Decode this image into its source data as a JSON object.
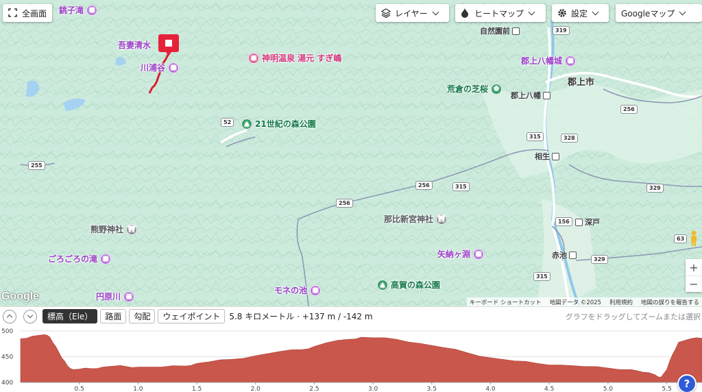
{
  "toolbar": {
    "fullscreen_label": "全画面",
    "layer_label": "レイヤー",
    "heatmap_label": "ヒートマップ",
    "settings_label": "設定",
    "basemap_label": "Googleマップ"
  },
  "map": {
    "places": [
      {
        "id": "choshi-taki",
        "name": "銚子滝",
        "kind": "purple",
        "icon": "landmark-icon"
      },
      {
        "id": "agatsuma-shimizu",
        "name": "吾妻清水",
        "kind": "purple",
        "icon": "landmark-icon"
      },
      {
        "id": "kawaura-tani",
        "name": "川浦谷",
        "kind": "purple",
        "icon": "landmark-icon"
      },
      {
        "id": "shinmei-onsen",
        "name": "神明温泉 湯元 すぎ嶋",
        "kind": "pink",
        "icon": "hotel-icon"
      },
      {
        "id": "mori-koen-21",
        "name": "21世紀の森公園",
        "kind": "green",
        "icon": "park-icon"
      },
      {
        "id": "arakura-shibazakura",
        "name": "荒倉の芝桜",
        "kind": "green",
        "icon": "flower-icon"
      },
      {
        "id": "gujo-hachiman-jo",
        "name": "郡上八幡城",
        "kind": "purple",
        "icon": "landmark-icon"
      },
      {
        "id": "kumano-jinja",
        "name": "熊野神社",
        "kind": "grey",
        "icon": "shrine-icon"
      },
      {
        "id": "gorogoro-taki",
        "name": "ごろごろの滝",
        "kind": "purple",
        "icon": "landmark-icon"
      },
      {
        "id": "nahi-shingu",
        "name": "那比新宮神社",
        "kind": "grey",
        "icon": "shrine-icon"
      },
      {
        "id": "yanagase",
        "name": "矢納ヶ淵",
        "kind": "purple",
        "icon": "landmark-icon"
      },
      {
        "id": "mone-ike",
        "name": "モネの池",
        "kind": "purple",
        "icon": "landmark-icon"
      },
      {
        "id": "takaga-mori",
        "name": "高賀の森公園",
        "kind": "green",
        "icon": "park-icon"
      },
      {
        "id": "enbaragawa",
        "name": "円原川",
        "kind": "purple",
        "icon": "landmark-icon"
      }
    ],
    "towns": {
      "gujo_city": "郡上市"
    },
    "stations": {
      "shizen_enmae": "自然園前",
      "gujo_hachiman": "郡上八幡",
      "aioi": "相生",
      "fukado": "深戸",
      "akaike": "赤池"
    },
    "routes": {
      "r319": "319",
      "r256a": "256",
      "r52": "52",
      "r315a": "315",
      "r328": "328",
      "r255": "255",
      "r256b": "256",
      "r315b": "315",
      "r256c": "256",
      "r329a": "329",
      "r156": "156",
      "r63": "63",
      "r329b": "329",
      "r315c": "315"
    },
    "zoom_in": "+",
    "zoom_out": "−",
    "google_logo": "Google",
    "attribution": {
      "shortcuts": "キーボード ショートカット",
      "data": "地図データ ©2025",
      "terms": "利用規約",
      "report": "地図の誤りを報告する"
    }
  },
  "elevation": {
    "tabs": [
      "標高（Ele）",
      "路面",
      "勾配",
      "ウェイポイント"
    ],
    "stats": "5.8 キロメートル · +137 m / -142 m",
    "hint": "グラフをドラッグしてズームまたは選択",
    "help": "?"
  },
  "chart_data": {
    "type": "area",
    "color": "#c9574c",
    "ylim": [
      400,
      500
    ],
    "xlim": [
      0,
      5.8
    ],
    "y_ticks": [
      400,
      450,
      500
    ],
    "x_ticks": [
      0.5,
      1.0,
      1.5,
      2.0,
      2.5,
      3.0,
      3.5,
      4.0,
      4.5,
      5.0,
      5.5
    ],
    "x_tick_labels": [
      "0.5",
      "1.0",
      "1.5",
      "2.0",
      "2.5",
      "3.0",
      "3.5",
      "4.0",
      "4.5",
      "5.0",
      "5.5"
    ],
    "y_tick_labels": [
      "500",
      "450",
      "400"
    ],
    "x": [
      0.0,
      0.1,
      0.2,
      0.25,
      0.3,
      0.35,
      0.4,
      0.45,
      0.5,
      0.6,
      0.7,
      0.8,
      0.9,
      1.0,
      1.2,
      1.4,
      1.5,
      1.6,
      1.8,
      2.0,
      2.2,
      2.4,
      2.5,
      2.6,
      2.8,
      2.9,
      3.0,
      3.2,
      3.4,
      3.6,
      3.8,
      4.0,
      4.2,
      4.4,
      4.6,
      4.8,
      5.0,
      5.2,
      5.3,
      5.4,
      5.45,
      5.5,
      5.55,
      5.6,
      5.7,
      5.8
    ],
    "y": [
      485,
      490,
      493,
      488,
      470,
      448,
      432,
      425,
      426,
      427,
      430,
      432,
      431,
      430,
      430,
      432,
      437,
      440,
      445,
      452,
      460,
      464,
      470,
      477,
      484,
      488,
      487,
      484,
      476,
      468,
      458,
      448,
      442,
      437,
      434,
      431,
      428,
      425,
      420,
      415,
      410,
      425,
      455,
      478,
      485,
      486
    ]
  }
}
